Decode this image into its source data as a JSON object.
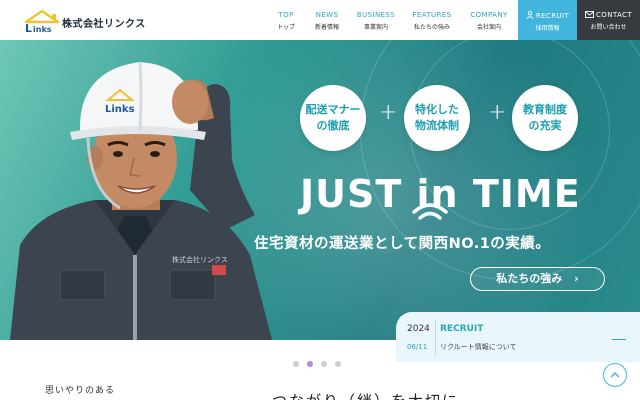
{
  "header": {
    "company_name": "株式会社リンクス",
    "logo_text": "Links",
    "nav": [
      {
        "en": "TOP",
        "ja": "トップ"
      },
      {
        "en": "NEWS",
        "ja": "新着情報"
      },
      {
        "en": "BUSINESS",
        "ja": "事業案内"
      },
      {
        "en": "FEATURES",
        "ja": "私たちの強み"
      },
      {
        "en": "COMPANY",
        "ja": "会社案内"
      }
    ],
    "recruit": {
      "en": "RECRUIT",
      "ja": "採用情報",
      "icon": "person-icon"
    },
    "contact": {
      "en": "CONTACT",
      "ja": "お問い合わせ",
      "icon": "mail-icon"
    }
  },
  "hero": {
    "bubbles": [
      {
        "line1": "配送マナー",
        "line2": "の徹底"
      },
      {
        "line1": "特化した",
        "line2": "物流体制"
      },
      {
        "line1": "教育制度",
        "line2": "の充実"
      }
    ],
    "plus": "+",
    "headline_part1": "JUST ",
    "headline_in": "in",
    "headline_part2": " TIME",
    "tagline": "住宅資材の運送業として関西NO.1の実績。",
    "cta_label": "私たちの強み",
    "cta_arrow": "›",
    "helmet_text": "Links",
    "worker_badge": "株式会社リンクス"
  },
  "news": {
    "year": "2024",
    "date": "06/11",
    "category": "RECRUIT",
    "title": "リクルート情報について"
  },
  "slider": {
    "count": 4,
    "active": 1
  },
  "intro_text": "思いやりのある",
  "headline_bottom": "つながり（絆）を大切に"
}
